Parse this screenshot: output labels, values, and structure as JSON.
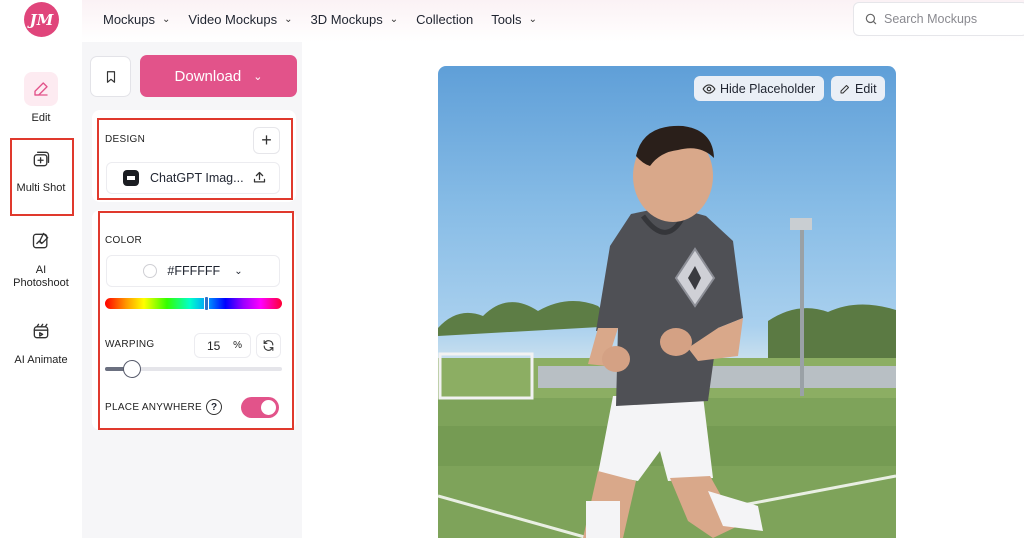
{
  "logo": {
    "text": "JM"
  },
  "rail": [
    {
      "label": "Edit",
      "icon": "pencil-icon"
    },
    {
      "label": "Multi Shot",
      "icon": "multi-shot-icon"
    },
    {
      "label": "AI Photoshoot",
      "icon": "ai-photoshoot-icon"
    },
    {
      "label": "AI Animate",
      "icon": "ai-animate-icon"
    }
  ],
  "nav": [
    {
      "label": "Mockups",
      "has_dropdown": true
    },
    {
      "label": "Video Mockups",
      "has_dropdown": true
    },
    {
      "label": "3D Mockups",
      "has_dropdown": true
    },
    {
      "label": "Collection",
      "has_dropdown": false
    },
    {
      "label": "Tools",
      "has_dropdown": true
    }
  ],
  "search": {
    "placeholder": "Search Mockups",
    "icon": "search-icon"
  },
  "toolbar": {
    "download_label": "Download",
    "bookmark_icon": "bookmark-icon"
  },
  "design": {
    "label": "DESIGN",
    "add_icon": "plus-icon",
    "file_name": "ChatGPT Imag...",
    "upload_icon": "upload-icon"
  },
  "color": {
    "label": "COLOR",
    "value": "#FFFFFF",
    "hue_position": 0.57
  },
  "warping": {
    "label": "WARPING",
    "value": "15",
    "unit": "%",
    "slider_fraction": 0.15,
    "reset_icon": "reset-icon"
  },
  "place_anywhere": {
    "label": "PLACE ANYWHERE",
    "help_icon": "help-icon",
    "enabled": true
  },
  "canvas": {
    "hide_placeholder_label": "Hide Placeholder",
    "edit_label": "Edit"
  },
  "colors": {
    "accent": "#E2538A",
    "highlight_border": "#E0392D"
  }
}
